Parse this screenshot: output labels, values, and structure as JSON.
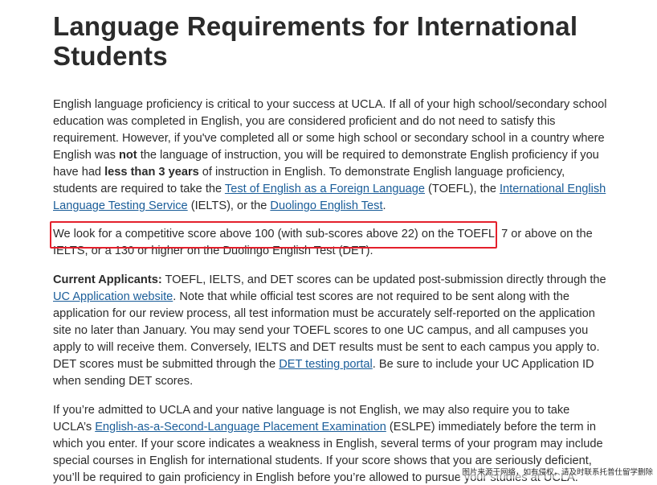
{
  "page": {
    "title": "Language Requirements for International Students"
  },
  "paragraph1": {
    "t1": "English language proficiency is critical to your success at UCLA. If all of your high school/secondary school education was completed in English, you are considered proficient and do not need to satisfy this requirement. However, if you've completed all or some high school or secondary school in a country where English was ",
    "b1": "not",
    "t2": " the language of instruction, you will be required to demonstrate English proficiency if you have had ",
    "b2": "less than 3 years",
    "t3": " of instruction in English. To demonstrate English language proficiency, students are required to take the ",
    "link_toefl": "Test of English as a Foreign Language",
    "t4": " (TOEFL), the ",
    "link_ielts": "International English Language Testing Service",
    "t5": " (IELTS), or the ",
    "link_duolingo": "Duolingo English Test",
    "t6": "."
  },
  "paragraph2": {
    "text": "We look for a competitive score above 100 (with sub-scores above 22) on the TOEFL, 7 or above on the IELTS, or a 130 or higher on the Duolingo English Test (DET)."
  },
  "paragraph3": {
    "lead": "Current Applicants:",
    "t1": " TOEFL, IELTS, and DET scores can be updated post-submission directly through the ",
    "link_uc_app": "UC Application website",
    "t2": ". Note that while official test scores are not required to be sent along with the application for our review process, all test information must be accurately self-reported on the application site no later than January. You may send your TOEFL scores to one UC campus, and all campuses you apply to will receive them. Conversely, IELTS and DET results must be sent to each campus you apply to. DET scores must be submitted through the ",
    "link_det_portal": "DET testing portal",
    "t3": ". Be sure to include your UC Application ID when sending DET scores."
  },
  "paragraph4": {
    "t1": "If you’re admitted to UCLA and your native language is not English, we may also require you to take UCLA’s ",
    "link_eslpe": "English-as-a-Second-Language Placement Examination",
    "t2": " (ESLPE) immediately before the term in which you enter. If your score indicates a weakness in English, several terms of your program may include special courses in English for international students. If your score shows that you are seriously deficient, you’ll be required to gain proficiency in English before you’re allowed to pursue your studies at UCLA."
  },
  "watermark": {
    "text": "图片来源于网络，如有侵权，请及时联系托普仕留学删除"
  },
  "colors": {
    "link": "#1a5d99",
    "highlight_border": "#e4202c",
    "text": "#2b2b2b"
  }
}
